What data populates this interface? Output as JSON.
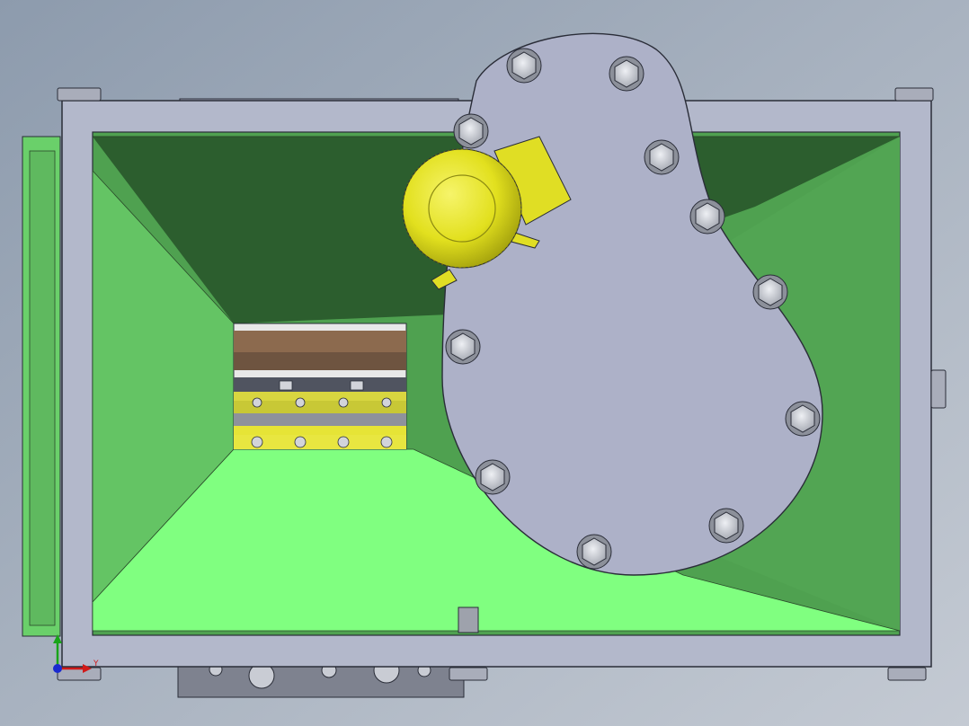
{
  "viewport": {
    "background_top": "#8d9bad",
    "background_bottom": "#c4cad3"
  },
  "colors": {
    "frame_steel": "#b3b8cb",
    "frame_edge": "#2a2d38",
    "hopper_dark": "#2c5e2e",
    "hopper_mid": "#4fa150",
    "hopper_light": "#64c464",
    "hopper_floor": "#80ff80",
    "side_strip": "#6ad06a",
    "motor_yellow": "#e4e224",
    "bolt_fill": "#d2d4da",
    "cover_plate": "#adb1c8"
  },
  "icons": {
    "triad": "coordinate-triad-icon",
    "bolt": "hex-bolt-icon"
  },
  "triad": {
    "y_axis_label": "Y"
  }
}
